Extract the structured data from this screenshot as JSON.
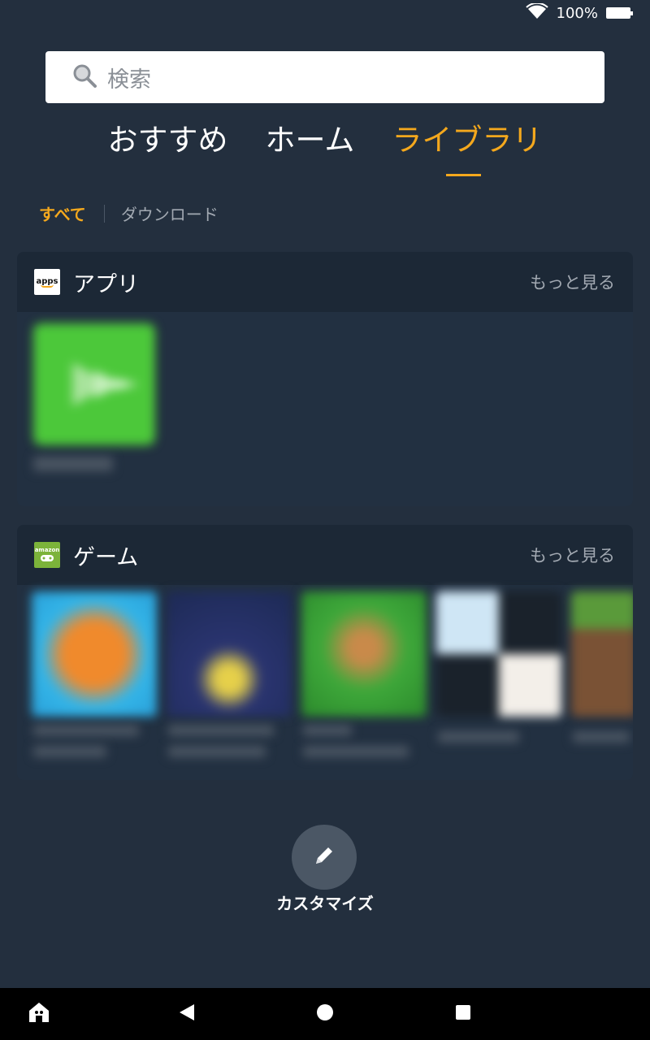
{
  "status": {
    "battery_text": "100%"
  },
  "search": {
    "placeholder": "検索"
  },
  "top_tabs": [
    {
      "label": "おすすめ",
      "active": false
    },
    {
      "label": "ホーム",
      "active": false
    },
    {
      "label": "ライブラリ",
      "active": true
    }
  ],
  "sub_tabs": {
    "all": "すべて",
    "download": "ダウンロード"
  },
  "apps_section": {
    "logo_text": "apps",
    "title": "アプリ",
    "more": "もっと見る"
  },
  "games_section": {
    "logo_text": "amazon",
    "title": "ゲーム",
    "more": "もっと見る"
  },
  "customize": {
    "label": "カスタマイズ"
  },
  "colors": {
    "background": "#232f3e",
    "accent": "#f4a81d",
    "card": "#223041",
    "card_header": "#1c2836"
  }
}
